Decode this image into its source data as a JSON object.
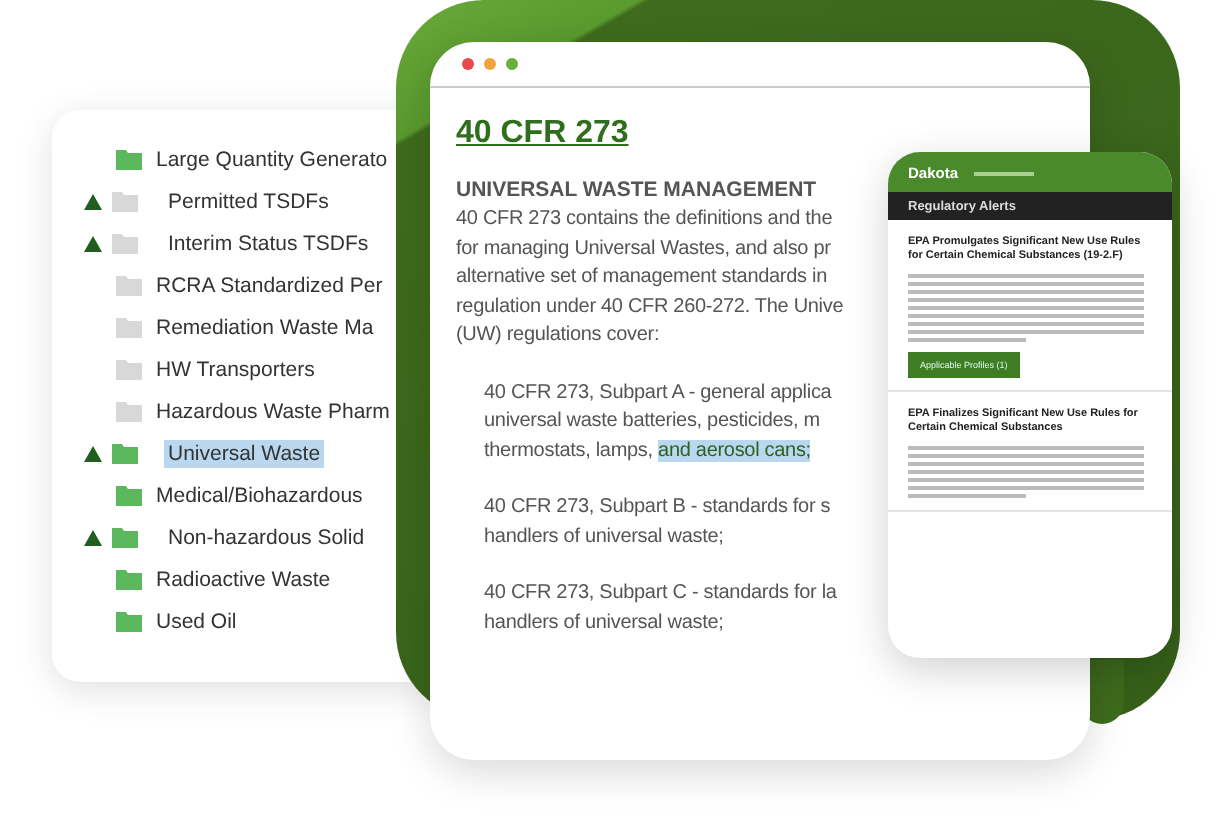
{
  "tree": {
    "items": [
      {
        "label": "Large Quantity Generato",
        "active": true,
        "children": [
          {
            "label": "Permitted TSDFs",
            "active": false,
            "selected": false
          },
          {
            "label": "Interim Status TSDFs",
            "active": false,
            "selected": false
          }
        ],
        "selected": false
      },
      {
        "label": "RCRA Standardized Per",
        "active": false,
        "selected": false
      },
      {
        "label": "Remediation Waste Ma",
        "active": false,
        "selected": false
      },
      {
        "label": "HW Transporters",
        "active": false,
        "selected": false
      },
      {
        "label": "Hazardous Waste Pharm",
        "active": false,
        "selected": false,
        "children": [
          {
            "label": "Universal Waste",
            "active": true,
            "selected": true
          }
        ]
      },
      {
        "label": "Medical/Biohazardous",
        "active": true,
        "selected": false,
        "children": [
          {
            "label": "Non-hazardous Solid",
            "active": true,
            "selected": false
          }
        ]
      },
      {
        "label": "Radioactive Waste",
        "active": true,
        "selected": false
      },
      {
        "label": "Used Oil",
        "active": true,
        "selected": false
      }
    ]
  },
  "document": {
    "title": "40 CFR 273",
    "heading": "UNIVERSAL WASTE MANAGEMENT",
    "intro": [
      "40 CFR 273 contains the definitions and the",
      "for managing Universal Wastes, and also pr",
      "alternative set of management standards in",
      "regulation under 40 CFR 260-272. The Unive",
      "(UW) regulations cover:"
    ],
    "subparts": [
      {
        "lines": [
          {
            "text": "40 CFR 273, Subpart A - general applica"
          },
          {
            "text": "universal waste batteries, pesticides, m"
          },
          {
            "text": "thermostats, lamps,",
            "highlight": "and aerosol cans;"
          }
        ]
      },
      {
        "lines": [
          {
            "text": "40 CFR 273, Subpart B - standards for s"
          },
          {
            "text": "handlers of universal waste;"
          }
        ]
      },
      {
        "lines": [
          {
            "text": "40 CFR 273, Subpart C - standards for la"
          },
          {
            "text": "handlers of universal waste;"
          }
        ]
      }
    ]
  },
  "phone": {
    "logo": "Dakota",
    "title": "Regulatory Alerts",
    "alerts": [
      {
        "title": "EPA Promulgates Significant New Use Rules for Certain Chemical Substances (19-2.F)",
        "button": "Applicable Profiles (1)"
      },
      {
        "title": "EPA Finalizes Significant New Use Rules for Certain Chemical Substances"
      }
    ]
  }
}
